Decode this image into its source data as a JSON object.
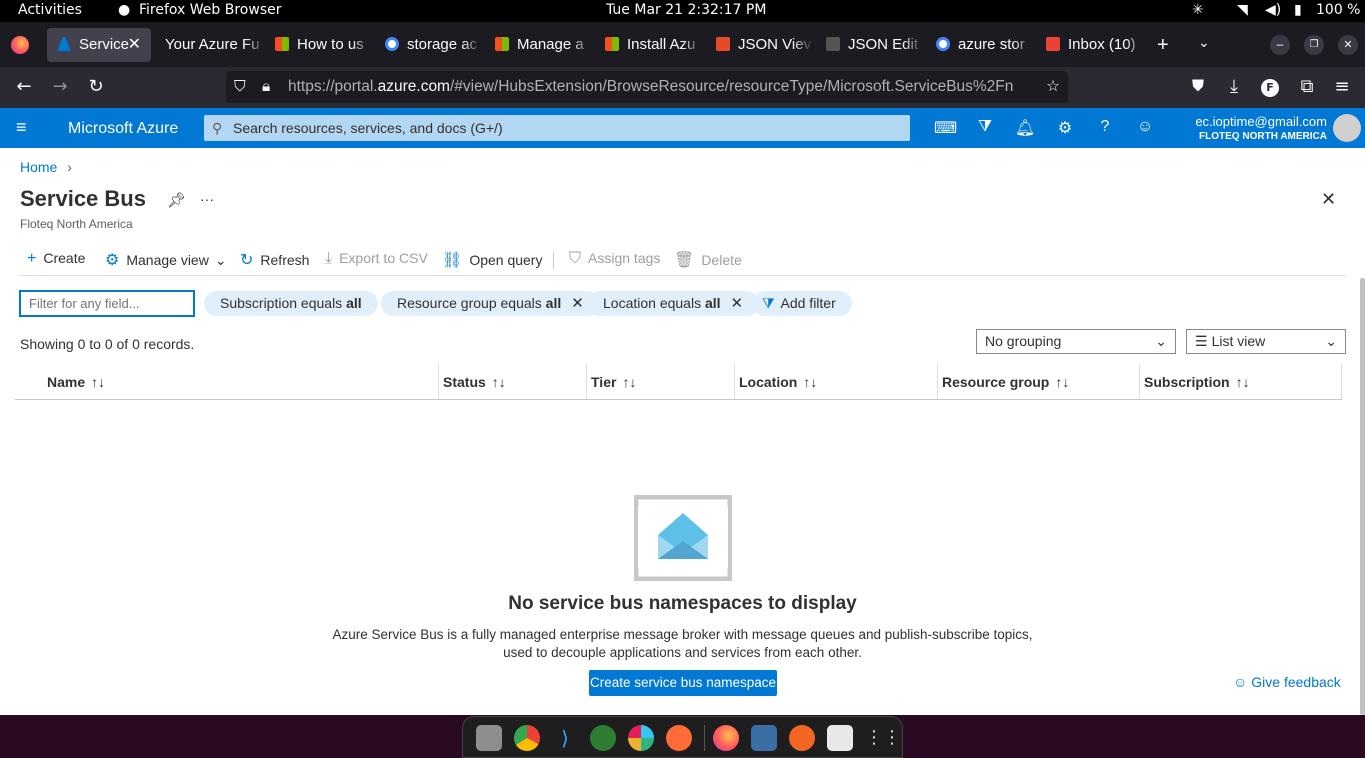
{
  "system_bar": {
    "activities": "Activities",
    "app": "Firefox Web Browser",
    "clock": "Tue Mar 21  2:32:17 PM",
    "battery": "100 %"
  },
  "tabs": [
    {
      "label": "Service",
      "color": "#0078d4"
    },
    {
      "label": "Your Azure Fu",
      "color": "#1c1b22"
    },
    {
      "label": "How to us",
      "color": "#f25022"
    },
    {
      "label": "storage ac",
      "color": "#4285f4"
    },
    {
      "label": "Manage a",
      "color": "#f25022"
    },
    {
      "label": "Install Azu",
      "color": "#f25022"
    },
    {
      "label": "JSON Viev",
      "color": "#e34c26"
    },
    {
      "label": "JSON Edit",
      "color": "#888888"
    },
    {
      "label": "azure stor",
      "color": "#4285f4"
    },
    {
      "label": "Inbox (10)",
      "color": "#ea4335"
    }
  ],
  "url": {
    "prefix": "https://portal.",
    "domain": "azure.com",
    "rest": "/#view/HubsExtension/BrowseResource/resourceType/Microsoft.ServiceBus%2Fn"
  },
  "azure": {
    "brand": "Microsoft Azure",
    "search_placeholder": "Search resources, services, and docs (G+/)",
    "user_email": "ec.ioptime@gmail.com",
    "user_org": "FLOTEQ NORTH AMERICA"
  },
  "page": {
    "breadcrumb_home": "Home",
    "title": "Service Bus",
    "subtitle": "Floteq North America",
    "more": "···"
  },
  "commands": {
    "create": "Create",
    "manage_view": "Manage view",
    "refresh": "Refresh",
    "export": "Export to CSV",
    "open_query": "Open query",
    "assign_tags": "Assign tags",
    "delete": "Delete"
  },
  "filters": {
    "input_placeholder": "Filter for any field...",
    "subscription_label": "Subscription equals ",
    "subscription_value": "all",
    "rg_label": "Resource group equals ",
    "rg_value": "all",
    "location_label": "Location equals ",
    "location_value": "all",
    "add_filter": "Add filter"
  },
  "records_text": "Showing 0 to 0 of 0 records.",
  "grouping": "No grouping",
  "view_mode": "List view",
  "columns": [
    "Name",
    "Status",
    "Tier",
    "Location",
    "Resource group",
    "Subscription"
  ],
  "empty": {
    "title": "No service bus namespaces to display",
    "desc_line1": "Azure Service Bus is a fully managed enterprise message broker with message queues and publish-subscribe topics,",
    "desc_line2": "used to decouple applications and services from each other.",
    "cta": "Create service bus namespace"
  },
  "feedback": "Give feedback",
  "colors": {
    "azure_blue": "#0078d4",
    "pill_bg": "#e1effa"
  }
}
